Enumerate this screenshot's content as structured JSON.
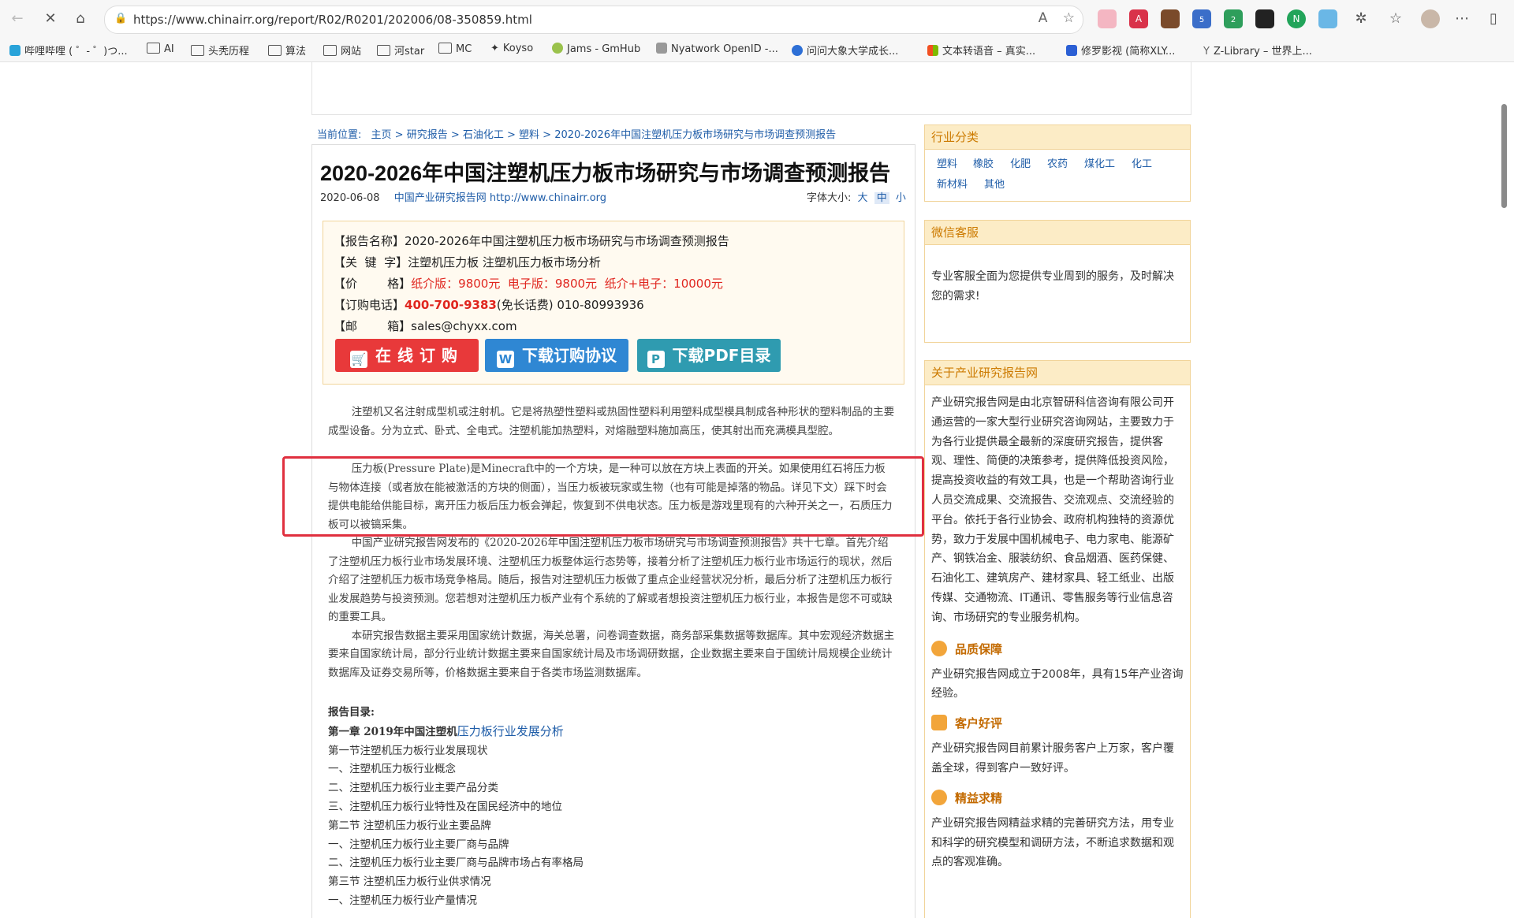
{
  "browser": {
    "url": "https://www.chinairr.org/report/R02/R0201/202006/08-350859.html",
    "bookmarks": [
      "哔哩哔哩 ( ゜- ゜)つ...",
      "AI",
      "头秃历程",
      "算法",
      "网站",
      "河star",
      "MC",
      "Koyso",
      "Jams - GmHub",
      "Nyatwork OpenID -...",
      "问问大象大学成长...",
      "文本转语音 – 真实...",
      "修罗影视 (简称XLY...",
      "Z-Library – 世界上..."
    ],
    "extensions": [
      {
        "icon": "badge-5-icon",
        "badge": "5",
        "color": "#2e7d32"
      },
      {
        "icon": "badge-2-icon",
        "badge": "2",
        "color": "#2e9e5b"
      }
    ]
  },
  "breadcrumb": {
    "prefix": "当前位置:",
    "items": [
      "主页 >",
      "研究报告 >",
      "石油化工 >",
      "塑料 >",
      "2020-2026年中国注塑机压力板市场研究与市场调查预测报告"
    ]
  },
  "report": {
    "title": "2020-2026年中国注塑机压力板市场研究与市场调查预测报告",
    "date": "2020-06-08",
    "source": "中国产业研究报告网 http://www.chinairr.org",
    "font_label": "字体大小:",
    "font_sizes": [
      "大",
      "中",
      "小"
    ]
  },
  "info": {
    "name_label": "【报告名称】",
    "name": "2020-2026年中国注塑机压力板市场研究与市场调查预测报告",
    "keyword_label": "【关  键  字】",
    "keywords": "注塑机压力板 注塑机压力板市场分析",
    "price_label": "【价        格】",
    "price": "纸介版：9800元  电子版：9800元  纸介+电子：10000元",
    "phone_label": "【订购电话】",
    "phone_hot": "400-700-9383",
    "phone_rest": "(免长话费) 010-80993936",
    "email_label": "【邮        箱】",
    "email": "sales@chyxx.com",
    "buttons": {
      "order": "在线订购",
      "agreement": "下载订购协议",
      "pdf": "下载PDF目录"
    }
  },
  "article": {
    "p1": "注塑机又名注射成型机或注射机。它是将热塑性塑料或热固性塑料利用塑料成型模具制成各种形状的塑料制品的主要成型设备。分为立式、卧式、全电式。注塑机能加热塑料，对熔融塑料施加高压，使其射出而充满模具型腔。",
    "p2": "压力板(Pressure Plate)是Minecraft中的一个方块，是一种可以放在方块上表面的开关。如果使用红石将压力板与物体连接（或者放在能被激活的方块的侧面），当压力板被玩家或生物（也有可能是掉落的物品。详见下文）踩下时会提供电能给供能目标，离开压力板后压力板会弹起，恢复到不供电状态。压力板是游戏里现有的六种开关之一，石质压力板可以被镐采集。",
    "p3": "中国产业研究报告网发布的《2020-2026年中国注塑机压力板市场研究与市场调查预测报告》共十七章。首先介绍了注塑机压力板行业市场发展环境、注塑机压力板整体运行态势等，接着分析了注塑机压力板行业市场运行的现状，然后介绍了注塑机压力板市场竞争格局。随后，报告对注塑机压力板做了重点企业经营状况分析，最后分析了注塑机压力板行业发展趋势与投资预测。您若想对注塑机压力板产业有个系统的了解或者想投资注塑机压力板行业，本报告是您不可或缺的重要工具。",
    "p4": "本研究报告数据主要采用国家统计数据，海关总署，问卷调查数据，商务部采集数据等数据库。其中宏观经济数据主要来自国家统计局，部分行业统计数据主要来自国家统计局及市场调研数据，企业数据主要来自于国统计局规模企业统计数据库及证券交易所等，价格数据主要来自于各类市场监测数据库。"
  },
  "toc": {
    "heading": "报告目录:",
    "chapter1_prefix": "第一章 2019年中国注塑机",
    "chapter1_link": "压力板行业发展分析",
    "items": [
      "第一节注塑机压力板行业发展现状",
      "一、注塑机压力板行业概念",
      "二、注塑机压力板行业主要产品分类",
      "三、注塑机压力板行业特性及在国民经济中的地位",
      "第二节 注塑机压力板行业主要品牌",
      "一、注塑机压力板行业主要厂商与品牌",
      "二、注塑机压力板行业主要厂商与品牌市场占有率格局",
      "第三节 注塑机压力板行业供求情况",
      "一、注塑机压力板行业产量情况"
    ]
  },
  "sidebar": {
    "industry_title": "行业分类",
    "industries": [
      "塑料",
      "橡胶",
      "化肥",
      "农药",
      "煤化工",
      "化工",
      "新材料",
      "其他"
    ],
    "wechat_title": "微信客服",
    "wechat_text": "专业客服全面为您提供专业周到的服务，及时解决您的需求!",
    "about_title": "关于产业研究报告网",
    "about_text": "产业研究报告网是由北京智研科信咨询有限公司开通运营的一家大型行业研究咨询网站，主要致力于为各行业提供最全最新的深度研究报告，提供客观、理性、简便的决策参考，提供降低投资风险，提高投资收益的有效工具，也是一个帮助咨询行业人员交流成果、交流报告、交流观点、交流经验的平台。依托于各行业协会、政府机构独特的资源优势，致力于发展中国机械电子、电力家电、能源矿产、钢铁冶金、服装纺织、食品烟酒、医药保健、石油化工、建筑房产、建材家具、轻工纸业、出版传媒、交通物流、IT通讯、零售服务等行业信息咨询、市场研究的专业服务机构。",
    "features": [
      {
        "title": "品质保障",
        "text": "产业研究报告网成立于2008年，具有15年产业咨询经验。"
      },
      {
        "title": "客户好评",
        "text": "产业研究报告网目前累计服务客户上万家，客户覆盖全球，得到客户一致好评。"
      },
      {
        "title": "精益求精",
        "text": "产业研究报告网精益求精的完善研究方法，用专业和科学的研究模型和调研方法，不断追求数据和观点的客观准确。"
      }
    ]
  },
  "colors": {
    "link": "#1f5da8",
    "highlight": "#e0303f",
    "price": "#e0261f",
    "accent": "#cc7a00"
  }
}
